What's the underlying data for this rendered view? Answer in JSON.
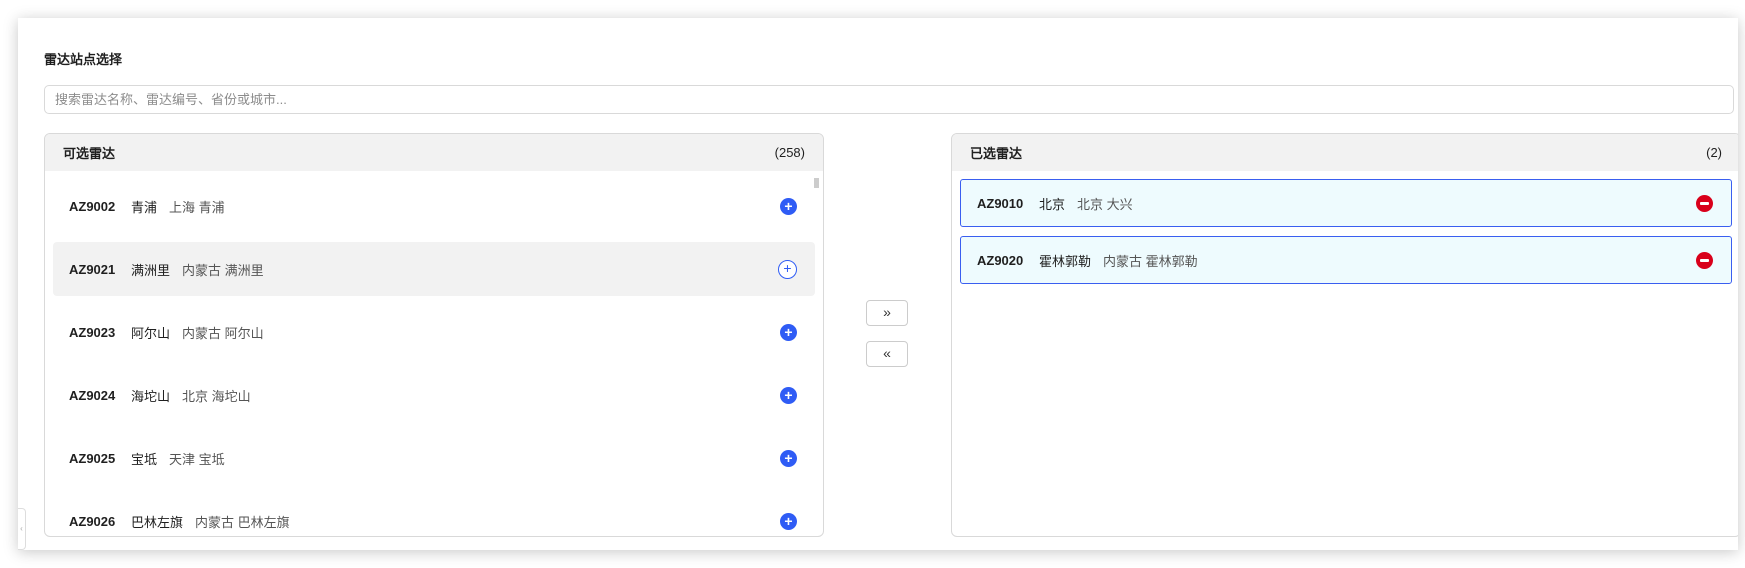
{
  "title": "雷达站点选择",
  "search": {
    "placeholder": "搜索雷达名称、雷达编号、省份或城市...",
    "value": ""
  },
  "available": {
    "header": "可选雷达",
    "count": "(258)",
    "items": [
      {
        "code": "AZ9002",
        "name": "青浦",
        "location": "上海 青浦"
      },
      {
        "code": "AZ9021",
        "name": "满洲里",
        "location": "内蒙古 满洲里"
      },
      {
        "code": "AZ9023",
        "name": "阿尔山",
        "location": "内蒙古 阿尔山"
      },
      {
        "code": "AZ9024",
        "name": "海坨山",
        "location": "北京 海坨山"
      },
      {
        "code": "AZ9025",
        "name": "宝坻",
        "location": "天津 宝坻"
      },
      {
        "code": "AZ9026",
        "name": "巴林左旗",
        "location": "内蒙古 巴林左旗"
      }
    ]
  },
  "selected": {
    "header": "已选雷达",
    "count": "(2)",
    "items": [
      {
        "code": "AZ9010",
        "name": "北京",
        "location": "北京 大兴"
      },
      {
        "code": "AZ9020",
        "name": "霍林郭勒",
        "location": "内蒙古 霍林郭勒"
      }
    ]
  },
  "buttons": {
    "move_right": "»",
    "move_left": "«",
    "add": "+",
    "collapse": "‹"
  },
  "colors": {
    "accent": "#2f5cf5",
    "remove": "#d9001b",
    "selected_bg": "#eefbfe"
  }
}
